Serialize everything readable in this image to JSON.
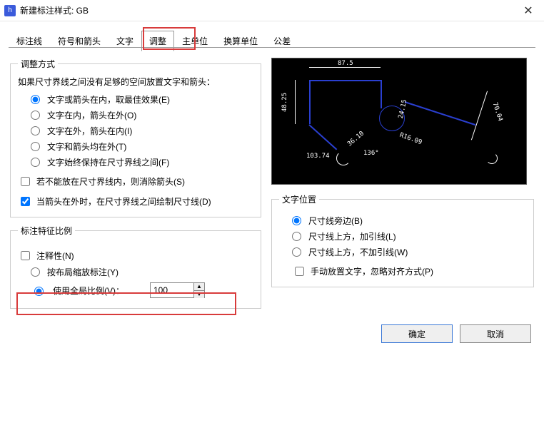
{
  "window": {
    "title": "新建标注样式: GB"
  },
  "tabs": [
    "标注线",
    "符号和箭头",
    "文字",
    "调整",
    "主单位",
    "换算单位",
    "公差"
  ],
  "tabs_active": "调整",
  "section_adjust": {
    "legend": "调整方式",
    "intro": "如果尺寸界线之间没有足够的空间放置文字和箭头：",
    "radio1": "文字或箭头在内，取最佳效果(E)",
    "radio2": "文字在内，箭头在外(O)",
    "radio3": "文字在外，箭头在内(I)",
    "radio4": "文字和箭头均在外(T)",
    "radio5": "文字始终保持在尺寸界线之间(F)",
    "chk1": "若不能放在尺寸界线内，则消除箭头(S)",
    "chk2": "当箭头在外时，在尺寸界线之间绘制尺寸线(D)"
  },
  "section_scale": {
    "legend": "标注特征比例",
    "chk_annotative": "注释性(N)",
    "radio_layout": "按布局缩放标注(Y)",
    "radio_global": "使用全局比例(V)：",
    "global_value": "100"
  },
  "section_textpos": {
    "legend": "文字位置",
    "radio1": "尺寸线旁边(B)",
    "radio2": "尺寸线上方，加引线(L)",
    "radio3": "尺寸线上方，不加引线(W)",
    "chk_manual": "手动放置文字，忽略对齐方式(P)"
  },
  "preview_labels": {
    "top": "87.5",
    "left": "48.25",
    "r": "24.15",
    "ang": "36.10",
    "deg": "136°",
    "rad": "R16.09",
    "bot": "103.74",
    "right": "70.04"
  },
  "buttons": {
    "ok": "确定",
    "cancel": "取消"
  }
}
